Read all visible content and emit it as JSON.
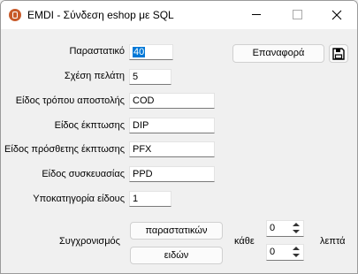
{
  "window": {
    "title": "EMDI - Σύνδεση eshop με SQL"
  },
  "form": {
    "fields": [
      {
        "label": "Παραστατικό",
        "value": "40",
        "selected": true
      },
      {
        "label": "Σχέση πελάτη",
        "value": "5"
      },
      {
        "label": "Είδος τρόπου αποστολής",
        "value": "COD"
      },
      {
        "label": "Είδος έκπτωσης",
        "value": "DIP"
      },
      {
        "label": "Είδος πρόσθετης έκπτωσης",
        "value": "PFX"
      },
      {
        "label": "Είδος συσκευασίας",
        "value": "PPD"
      },
      {
        "label": "Υποκατηγορία είδους",
        "value": "1"
      }
    ]
  },
  "buttons": {
    "reset": "Επαναφορά",
    "save_icon": "save-icon"
  },
  "sync": {
    "label": "Συγχρονισμός",
    "docs_button": "παραστατικών",
    "items_button": "ειδών",
    "every_label": "κάθε",
    "minutes_label": "λεπτά",
    "docs_interval": "0",
    "items_interval": "0"
  }
}
